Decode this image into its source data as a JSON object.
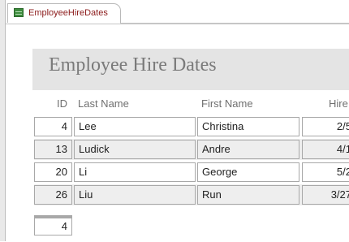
{
  "tab": {
    "icon": "report-icon",
    "label": "EmployeeHireDates"
  },
  "report": {
    "title": "Employee Hire Dates",
    "columns": {
      "id": "ID",
      "last_name": "Last Name",
      "first_name": "First Name",
      "hire": "Hire"
    },
    "rows": [
      {
        "id": "4",
        "last_name": "Lee",
        "first_name": "Christina",
        "hire": "2/5"
      },
      {
        "id": "13",
        "last_name": "Ludick",
        "first_name": "Andre",
        "hire": "4/1"
      },
      {
        "id": "20",
        "last_name": "Li",
        "first_name": "George",
        "hire": "5/2"
      },
      {
        "id": "26",
        "last_name": "Liu",
        "first_name": "Run",
        "hire": "3/27"
      }
    ],
    "count": "4"
  },
  "colors": {
    "tab_label": "#8b1a1a",
    "header_band": "#e4e4e4",
    "alt_row": "#eeeeee"
  }
}
